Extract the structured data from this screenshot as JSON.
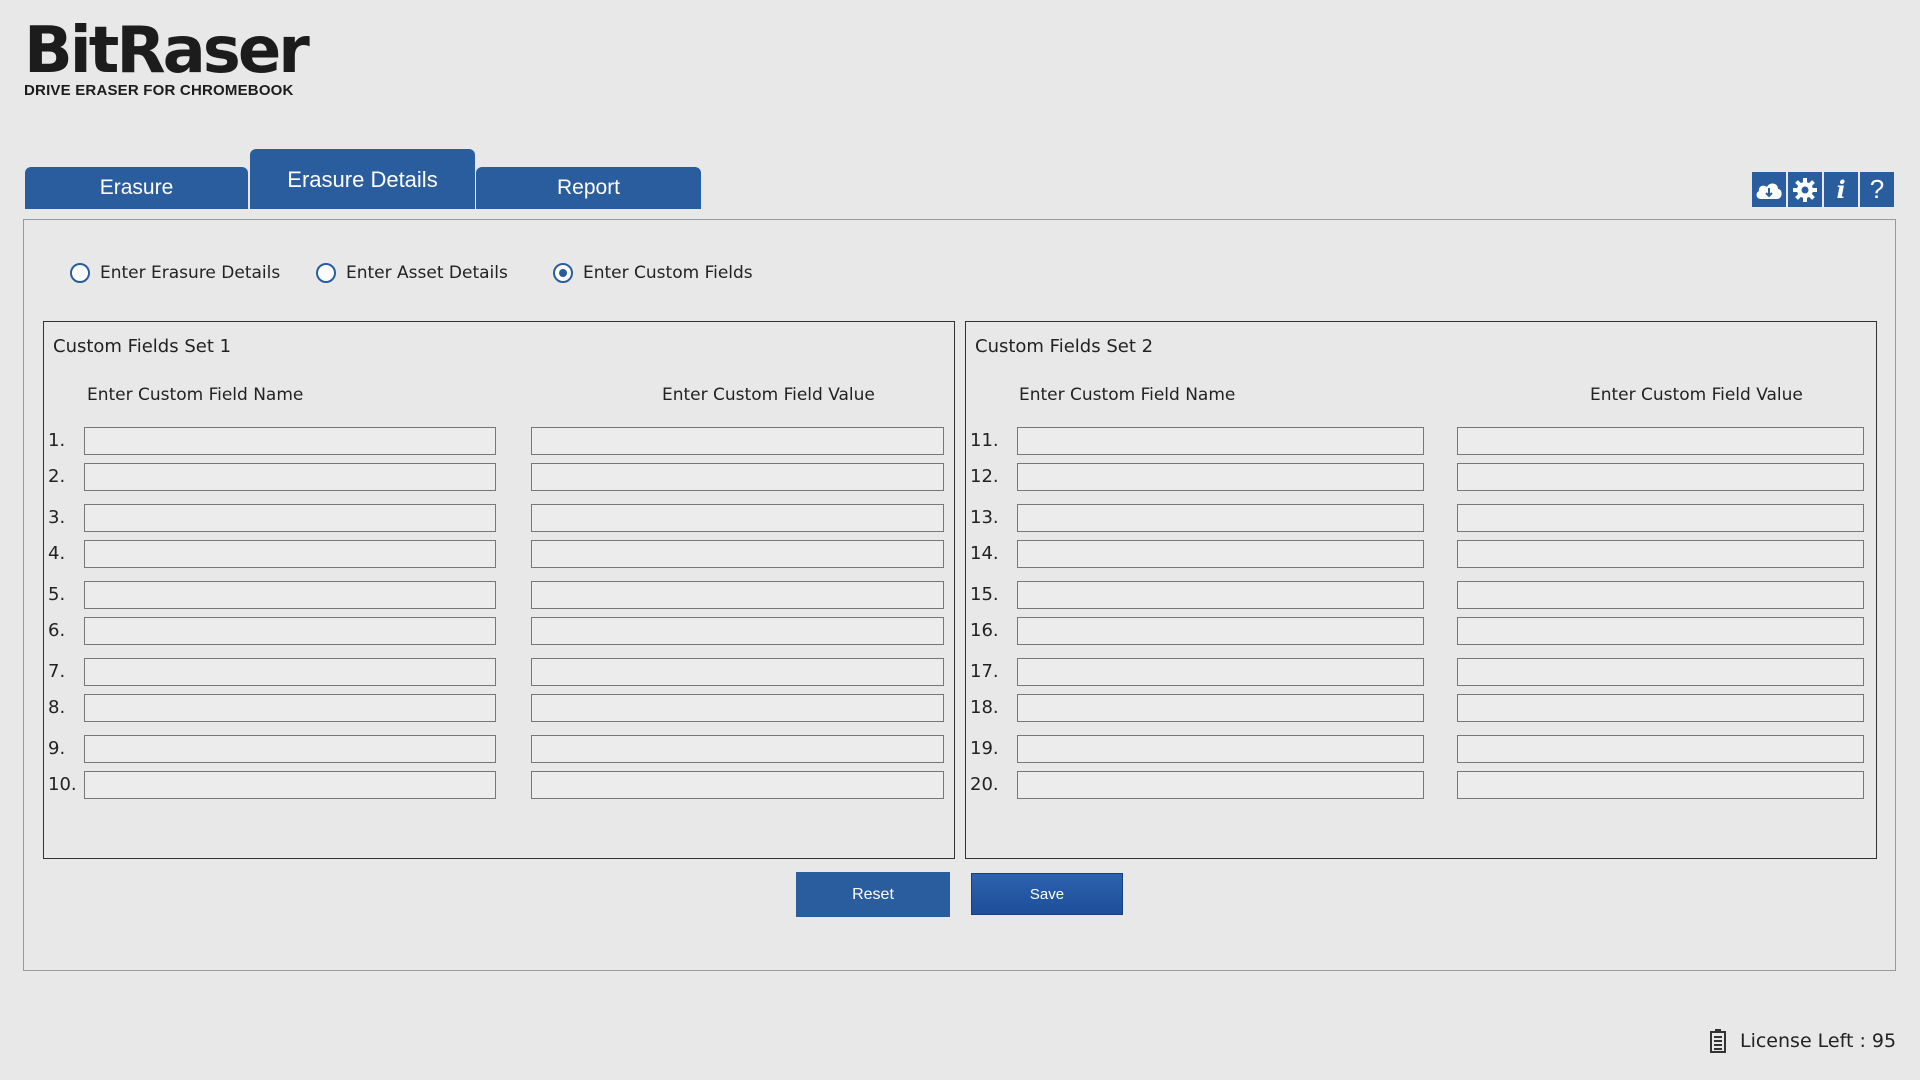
{
  "logo": {
    "title": "BitRaser",
    "subtitle": "DRIVE ERASER FOR CHROMEBOOK"
  },
  "tabs": [
    {
      "label": "Erasure",
      "active": false
    },
    {
      "label": "Erasure Details",
      "active": true
    },
    {
      "label": "Report",
      "active": false
    }
  ],
  "toolbar": {
    "icons": [
      "cloud-icon",
      "gear-icon",
      "info-icon",
      "help-icon"
    ],
    "info_glyph": "i",
    "help_glyph": "?"
  },
  "radio_options": [
    {
      "label": "Enter Erasure Details",
      "checked": false
    },
    {
      "label": "Enter Asset Details",
      "checked": false
    },
    {
      "label": "Enter Custom Fields",
      "checked": true
    }
  ],
  "set1": {
    "title": "Custom Fields Set 1",
    "name_header": "Enter Custom Field Name",
    "value_header": "Enter Custom Field Value",
    "rows": [
      {
        "num": "1.",
        "name": "",
        "value": ""
      },
      {
        "num": "2.",
        "name": "",
        "value": ""
      },
      {
        "num": "3.",
        "name": "",
        "value": ""
      },
      {
        "num": "4.",
        "name": "",
        "value": ""
      },
      {
        "num": "5.",
        "name": "",
        "value": ""
      },
      {
        "num": "6.",
        "name": "",
        "value": ""
      },
      {
        "num": "7.",
        "name": "",
        "value": ""
      },
      {
        "num": "8.",
        "name": "",
        "value": ""
      },
      {
        "num": "9.",
        "name": "",
        "value": ""
      },
      {
        "num": "10.",
        "name": "",
        "value": ""
      }
    ]
  },
  "set2": {
    "title": "Custom Fields Set 2",
    "name_header": "Enter Custom Field Name",
    "value_header": "Enter Custom Field Value",
    "rows": [
      {
        "num": "11.",
        "name": "",
        "value": ""
      },
      {
        "num": "12.",
        "name": "",
        "value": ""
      },
      {
        "num": "13.",
        "name": "",
        "value": ""
      },
      {
        "num": "14.",
        "name": "",
        "value": ""
      },
      {
        "num": "15.",
        "name": "",
        "value": ""
      },
      {
        "num": "16.",
        "name": "",
        "value": ""
      },
      {
        "num": "17.",
        "name": "",
        "value": ""
      },
      {
        "num": "18.",
        "name": "",
        "value": ""
      },
      {
        "num": "19.",
        "name": "",
        "value": ""
      },
      {
        "num": "20.",
        "name": "",
        "value": ""
      }
    ]
  },
  "buttons": {
    "reset": "Reset",
    "save": "Save"
  },
  "license": {
    "text": "License Left :  95"
  },
  "colors": {
    "accent": "#2a5d9e",
    "background": "#e8e8e8"
  }
}
